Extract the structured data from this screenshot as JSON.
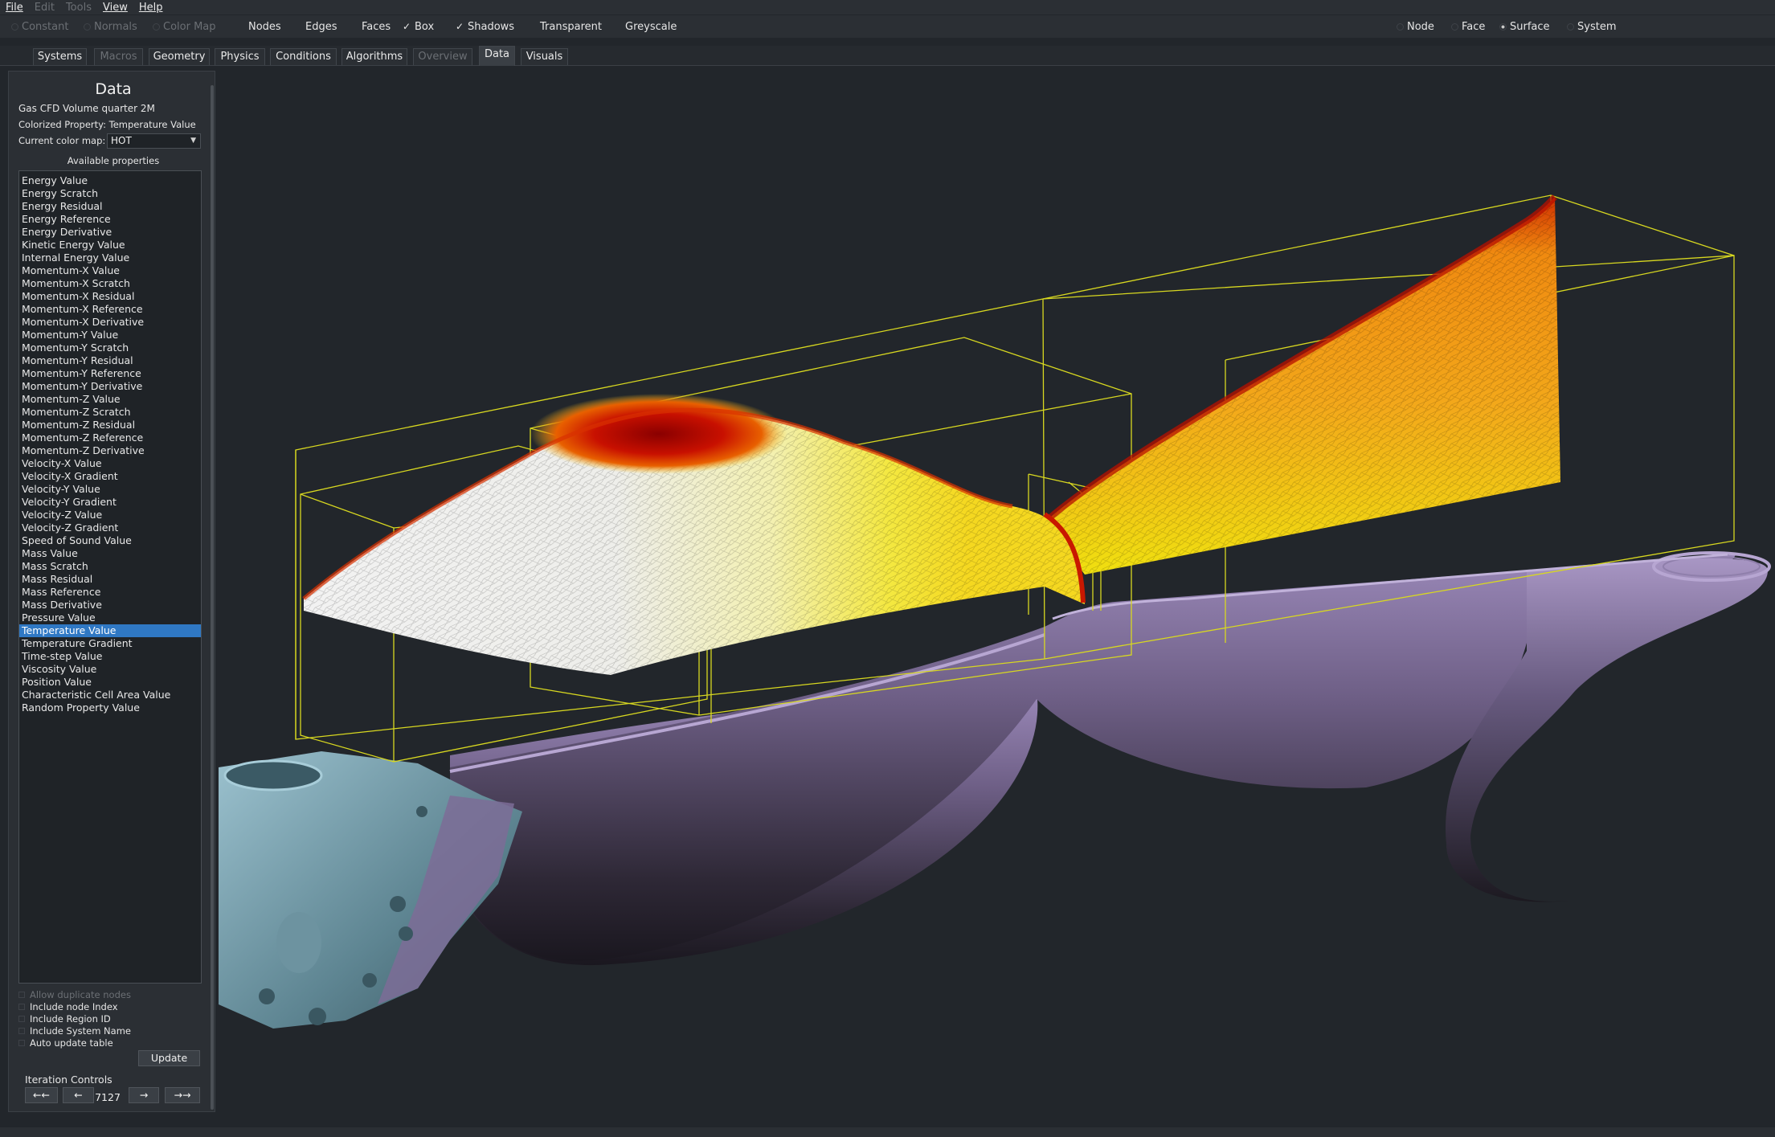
{
  "menu": {
    "items": [
      {
        "label": "File",
        "enabled": true
      },
      {
        "label": "Edit",
        "enabled": false
      },
      {
        "label": "Tools",
        "enabled": false
      },
      {
        "label": "View",
        "enabled": true
      },
      {
        "label": "Help",
        "enabled": true
      }
    ]
  },
  "toolbar": {
    "constant": "Constant",
    "normals": "Normals",
    "color_map": "Color Map",
    "nodes": "Nodes",
    "edges": "Edges",
    "faces": "Faces",
    "box": "Box",
    "box_checked": true,
    "shadows": "Shadows",
    "shadows_checked": true,
    "transparent": "Transparent",
    "greyscale": "Greyscale",
    "select_node": "Node",
    "select_face": "Face",
    "select_surface": "Surface",
    "select_system": "System",
    "selected_mode": "Surface"
  },
  "tabs": [
    {
      "label": "Systems",
      "enabled": true
    },
    {
      "label": "Macros",
      "enabled": false
    },
    {
      "label": "Geometry",
      "enabled": true
    },
    {
      "label": "Physics",
      "enabled": true
    },
    {
      "label": "Conditions",
      "enabled": true
    },
    {
      "label": "Algorithms",
      "enabled": true
    },
    {
      "label": "Overview",
      "enabled": false
    },
    {
      "label": "Data",
      "enabled": true,
      "active": true
    },
    {
      "label": "Visuals",
      "enabled": true
    }
  ],
  "panel": {
    "title": "Data",
    "dataset": "Gas CFD Volume quarter 2M",
    "colorized_property": "Colorized Property: Temperature Value",
    "color_map_label": "Current color map:",
    "color_map_value": "HOT",
    "available_label": "Available properties",
    "properties": [
      "Energy Value",
      "Energy Scratch",
      "Energy Residual",
      "Energy Reference",
      "Energy Derivative",
      "Kinetic Energy Value",
      "Internal Energy Value",
      "Momentum-X Value",
      "Momentum-X Scratch",
      "Momentum-X Residual",
      "Momentum-X Reference",
      "Momentum-X Derivative",
      "Momentum-Y Value",
      "Momentum-Y Scratch",
      "Momentum-Y Residual",
      "Momentum-Y Reference",
      "Momentum-Y Derivative",
      "Momentum-Z Value",
      "Momentum-Z Scratch",
      "Momentum-Z Residual",
      "Momentum-Z Reference",
      "Momentum-Z Derivative",
      "Velocity-X Value",
      "Velocity-X Gradient",
      "Velocity-Y Value",
      "Velocity-Y Gradient",
      "Velocity-Z Value",
      "Velocity-Z Gradient",
      "Speed of Sound Value",
      "Mass Value",
      "Mass Scratch",
      "Mass Residual",
      "Mass Reference",
      "Mass Derivative",
      "Pressure Value",
      "Temperature Value",
      "Temperature Gradient",
      "Time-step Value",
      "Viscosity Value",
      "Position Value",
      "Characteristic Cell Area Value",
      "Random Property Value"
    ],
    "selected_property": "Temperature Value",
    "options": {
      "allow_duplicate_nodes": "Allow duplicate nodes",
      "include_node_index": "Include node Index",
      "include_region_id": "Include Region ID",
      "include_system_name": "Include System Name",
      "auto_update_table": "Auto update table"
    },
    "update_button": "Update",
    "iteration_label": "Iteration Controls",
    "iter_first": "←←",
    "iter_prev": "←",
    "iteration_value": "7127",
    "iter_next": "→",
    "iter_last": "→→"
  },
  "colors": {
    "selection": "#2f78c4",
    "bounding_box": "#d8d820",
    "duct_surface": "#8a7aa6",
    "engine_block": "#7fa6b4",
    "background": "#22262b"
  }
}
